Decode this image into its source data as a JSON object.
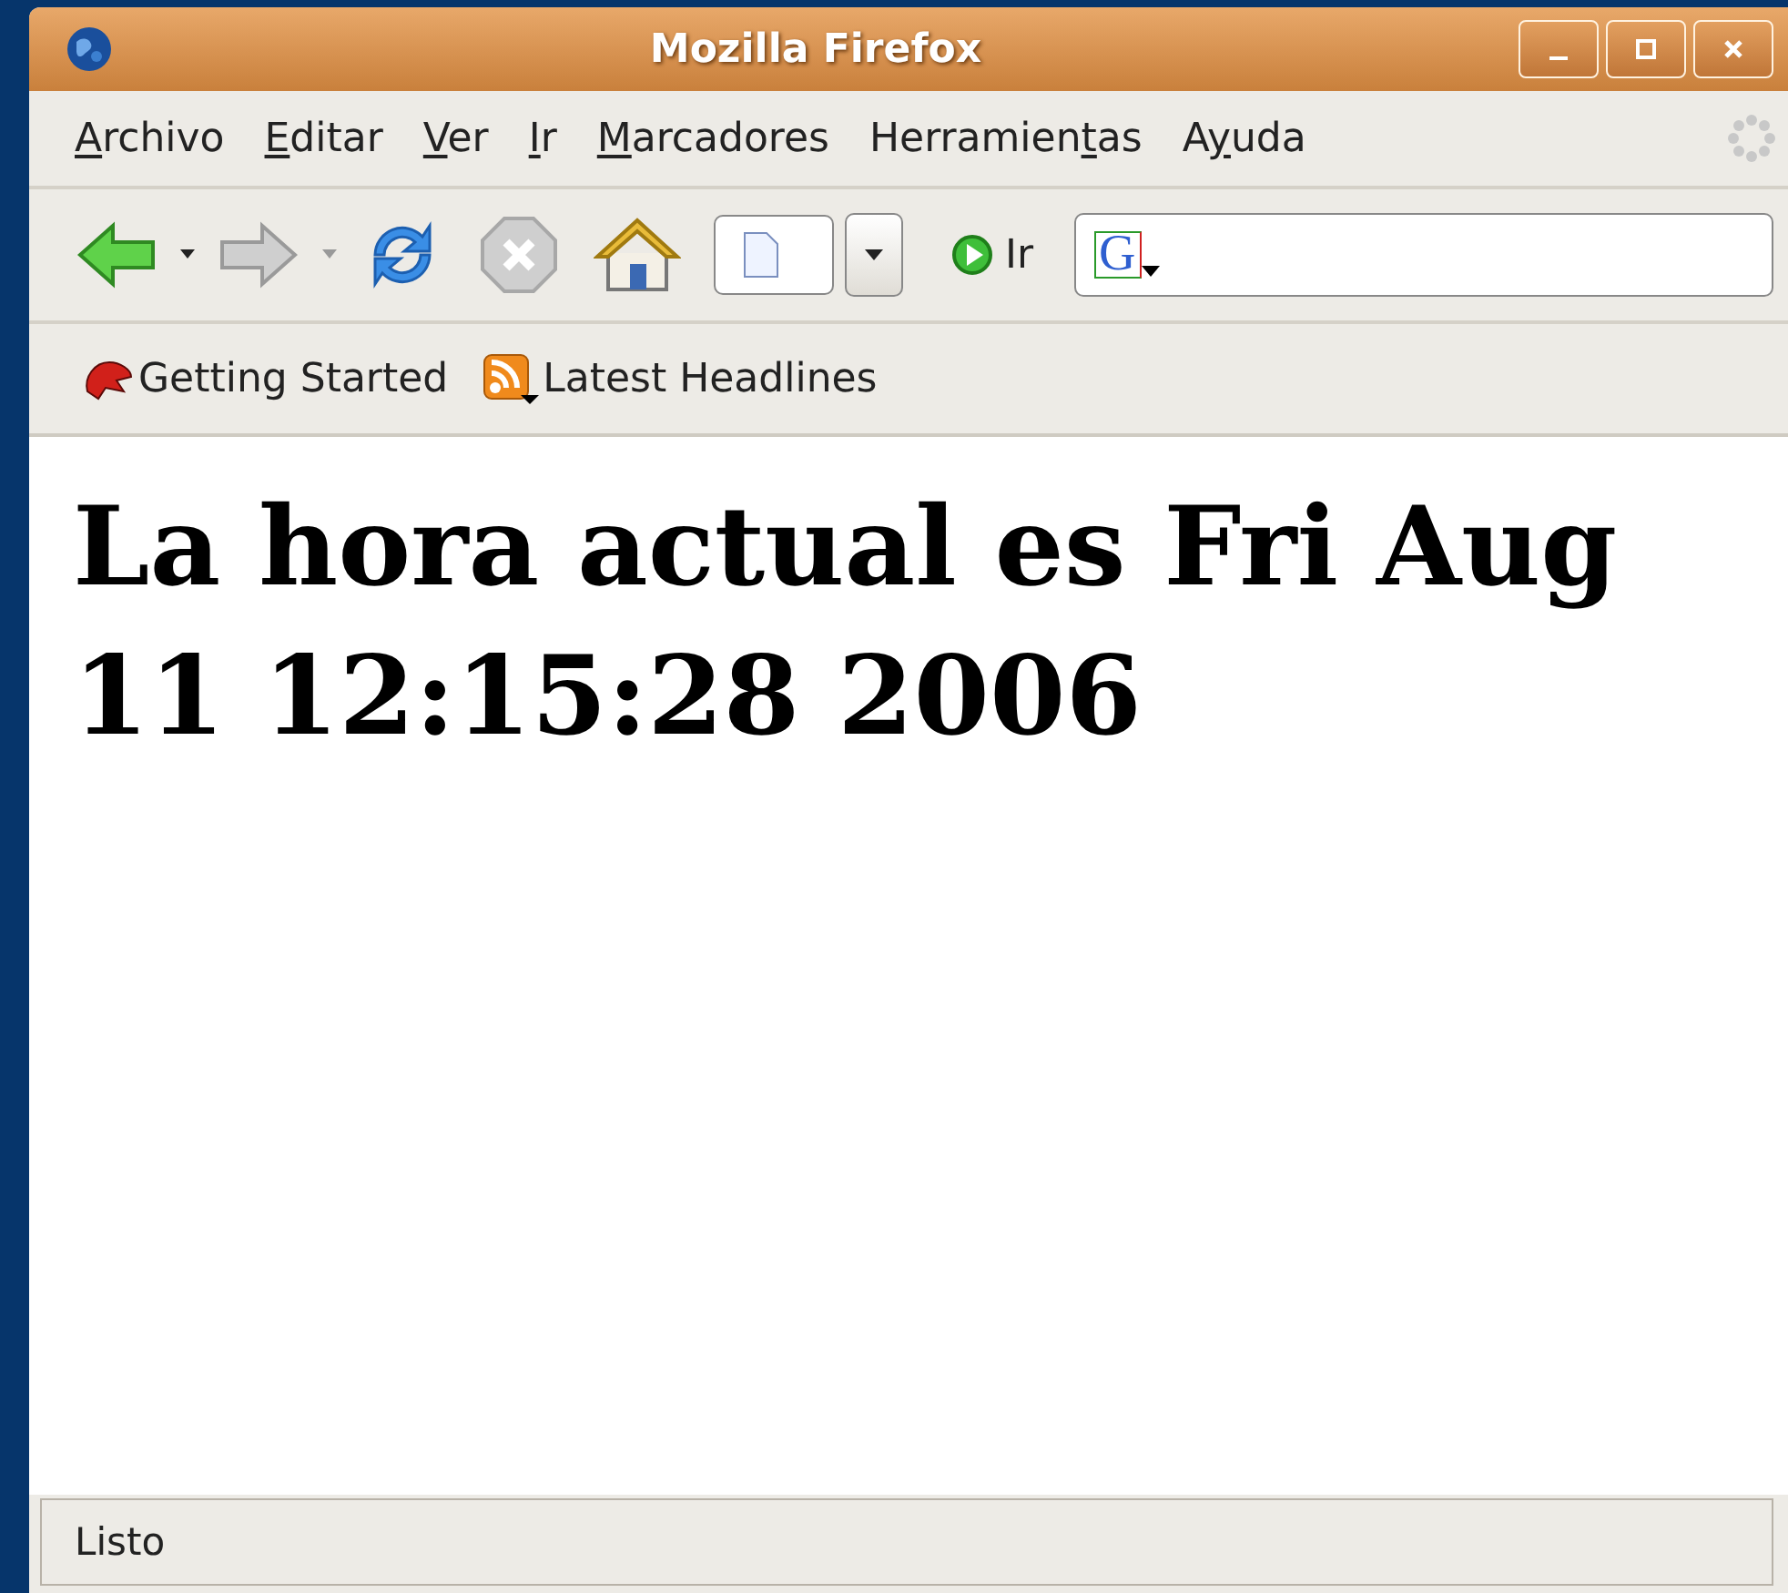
{
  "window": {
    "title": "Mozilla Firefox"
  },
  "menu": [
    {
      "key": "A",
      "after": "rchivo"
    },
    {
      "key": "E",
      "after": "ditar"
    },
    {
      "key": "V",
      "after": "er"
    },
    {
      "key": "I",
      "after": "r"
    },
    {
      "key": "M",
      "after": "arcadores"
    },
    {
      "before": "Herramien",
      "key": "t",
      "after": "as"
    },
    {
      "before": "A",
      "key": "y",
      "after": "uda"
    }
  ],
  "search": {
    "engine_letter": "G"
  },
  "toolbar": {
    "back": {
      "disabled": false
    },
    "forward": {
      "disabled": true
    },
    "stop": {
      "disabled": true
    },
    "go_label": "Ir"
  },
  "bookmarks": [
    {
      "label": "Getting Started",
      "kind": "page"
    },
    {
      "label": "Latest Headlines",
      "kind": "feed"
    }
  ],
  "page": {
    "heading": "La hora actual es Fri Aug 11 12:15:28 2006"
  },
  "status_bar": {
    "text": "Listo"
  }
}
